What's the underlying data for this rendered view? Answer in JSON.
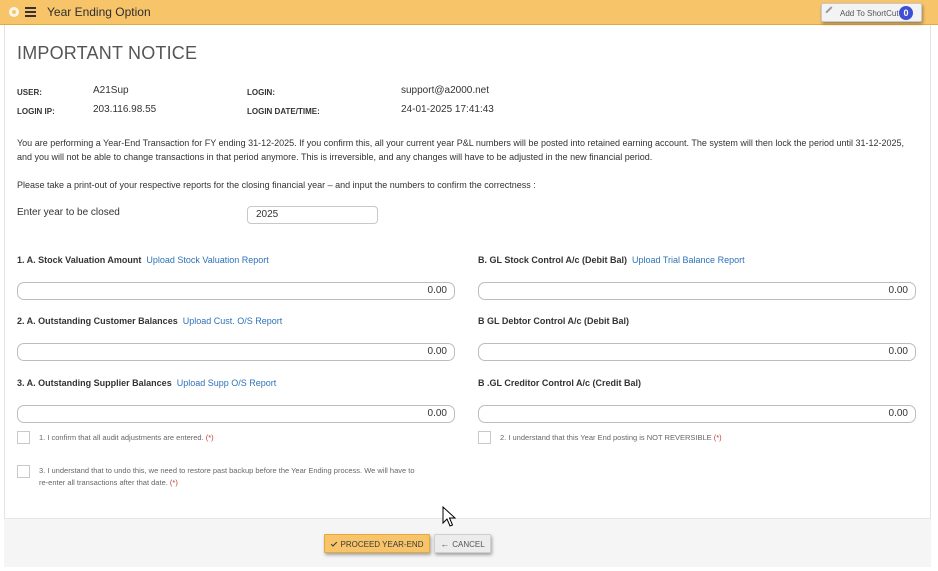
{
  "topbar": {
    "title": "Year Ending Option",
    "shortcut_label": "Add To ShortCut",
    "shortcut_count": "0"
  },
  "notice": {
    "heading": "IMPORTANT NOTICE"
  },
  "info": {
    "user_label": "USER:",
    "user_value": "A21Sup",
    "login_label": "LOGIN:",
    "login_value": "support@a2000.net",
    "ip_label": "LOGIN IP:",
    "ip_value": "203.116.98.55",
    "datetime_label": "LOGIN DATE/TIME:",
    "datetime_value": "24-01-2025 17:41:43"
  },
  "text": {
    "warning": "You are performing a Year-End Transaction for FY ending 31-12-2025. If you confirm this, all your current year P&L numbers will be posted into retained earning account. The system will then lock the period until 31-12-2025, and you will not be able to change transactions in that period anymore. This is irreversible, and any changes will have to be adjusted in the new financial period.",
    "instruction": "Please take a print-out of your respective reports for the closing financial year – and input the numbers to confirm the correctness :"
  },
  "year": {
    "label": "Enter year to be closed",
    "value": "2025"
  },
  "fields": {
    "stock_valuation": {
      "title": "1. A. Stock Valuation Amount",
      "link": "Upload Stock Valuation Report",
      "value": "0.00"
    },
    "gl_stock": {
      "title": "B. GL Stock Control A/c (Debit Bal)",
      "link": "Upload Trial Balance Report",
      "value": "0.00"
    },
    "customer": {
      "title": "2. A. Outstanding Customer Balances",
      "link": "Upload Cust. O/S Report",
      "value": "0.00"
    },
    "gl_debtor": {
      "title": "B GL Debtor Control A/c (Debit Bal)",
      "value": "0.00"
    },
    "supplier": {
      "title": "3. A. Outstanding Supplier Balances",
      "link": "Upload Supp O/S Report",
      "value": "0.00"
    },
    "gl_creditor": {
      "title": "B .GL Creditor Control A/c (Credit Bal)",
      "value": "0.00"
    }
  },
  "confirmations": {
    "c1": "1. I confirm that all audit adjustments are entered.",
    "c2": "2. I understand that this Year End posting is NOT REVERSIBLE",
    "c3_line1": "3. I understand that to undo this, we need to restore past backup before the Year Ending process. We will have to",
    "c3_line2": "re-enter all transactions after that date.",
    "required_mark": "(*)"
  },
  "buttons": {
    "proceed": "PROCEED YEAR-END",
    "cancel": "CANCEL"
  },
  "colors": {
    "accent": "#f7c46a",
    "link": "#2d72b8",
    "badge": "#3e4fd1"
  }
}
